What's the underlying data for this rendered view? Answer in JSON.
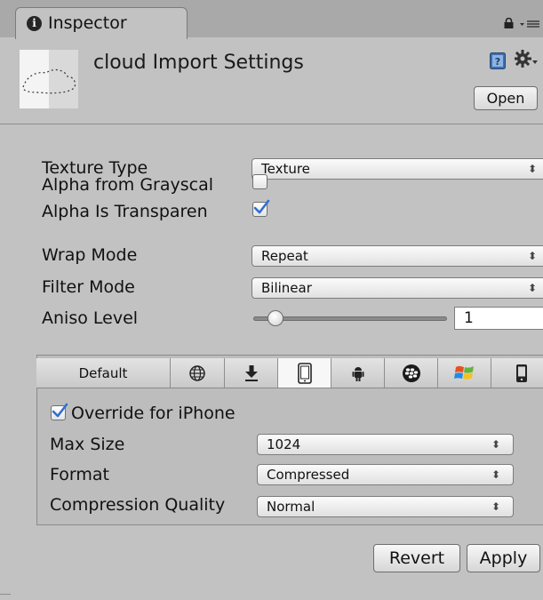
{
  "window": {
    "tab_label": "Inspector",
    "tab_icon": "info-icon",
    "header_icons": [
      "lock-icon",
      "menu-icon"
    ]
  },
  "header": {
    "title": "cloud Import Settings",
    "open_label": "Open",
    "icons": [
      "help-icon",
      "gear-icon"
    ]
  },
  "texture": {
    "texture_type": {
      "label": "Texture Type",
      "value": "Texture"
    },
    "alpha_from_grayscale": {
      "label": "Alpha from Grayscal",
      "checked": false
    },
    "alpha_is_transparency": {
      "label": "Alpha Is Transparen",
      "checked": true
    },
    "wrap_mode": {
      "label": "Wrap Mode",
      "value": "Repeat"
    },
    "filter_mode": {
      "label": "Filter Mode",
      "value": "Bilinear"
    },
    "aniso_level": {
      "label": "Aniso Level",
      "value": "1",
      "slider_fraction": 0.1
    }
  },
  "platforms": {
    "tabs": [
      {
        "label": "Default",
        "icon": null
      },
      {
        "icon": "globe-icon"
      },
      {
        "icon": "download-icon"
      },
      {
        "icon": "iphone-icon",
        "selected": true
      },
      {
        "icon": "android-icon"
      },
      {
        "icon": "blackberry-icon"
      },
      {
        "icon": "windows-flag-icon"
      },
      {
        "icon": "phone-icon"
      }
    ],
    "override": {
      "label": "Override for iPhone",
      "checked": true
    },
    "max_size": {
      "label": "Max Size",
      "value": "1024"
    },
    "format": {
      "label": "Format",
      "value": "Compressed"
    },
    "compression_quality": {
      "label": "Compression Quality",
      "value": "Normal"
    }
  },
  "actions": {
    "revert_label": "Revert",
    "apply_label": "Apply"
  },
  "colors": {
    "panel": "#c2c2c2",
    "check_blue": "#2f6fd1"
  }
}
